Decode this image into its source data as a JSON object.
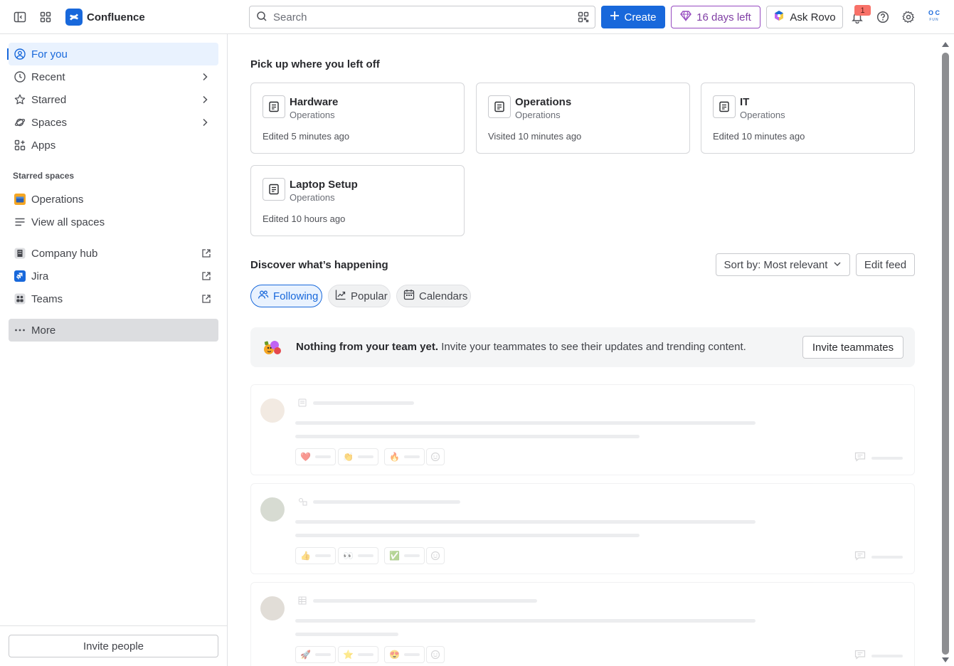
{
  "topbar": {
    "app_name": "Confluence",
    "search_placeholder": "Search",
    "create_label": "Create",
    "trial_label": "16 days left",
    "rovo_label": "Ask Rovo",
    "notification_count": "1",
    "avatar_initials_top": "O C",
    "avatar_initials_bottom": "FUN"
  },
  "sidebar": {
    "items": [
      {
        "label": "For you"
      },
      {
        "label": "Recent"
      },
      {
        "label": "Starred"
      },
      {
        "label": "Spaces"
      },
      {
        "label": "Apps"
      }
    ],
    "starred_heading": "Starred spaces",
    "starred": [
      {
        "label": "Operations"
      },
      {
        "label": "View all spaces"
      }
    ],
    "links": [
      {
        "label": "Company hub"
      },
      {
        "label": "Jira"
      },
      {
        "label": "Teams"
      }
    ],
    "more_label": "More",
    "invite_label": "Invite people"
  },
  "main": {
    "pickup_title": "Pick up where you left off",
    "cards": [
      {
        "title": "Hardware",
        "space": "Operations",
        "meta": "Edited 5 minutes ago"
      },
      {
        "title": "Operations",
        "space": "Operations",
        "meta": "Visited 10 minutes ago"
      },
      {
        "title": "IT",
        "space": "Operations",
        "meta": "Edited 10 minutes ago"
      },
      {
        "title": "Laptop Setup",
        "space": "Operations",
        "meta": "Edited 10 hours ago"
      }
    ],
    "discover_title": "Discover what’s happening",
    "sort_label": "Sort by: Most relevant",
    "edit_feed_label": "Edit feed",
    "filters": [
      {
        "label": "Following"
      },
      {
        "label": "Popular"
      },
      {
        "label": "Calendars"
      }
    ],
    "banner": {
      "bold": "Nothing from your team yet.",
      "text": " Invite your teammates to see their updates and trending content.",
      "button": "Invite teammates"
    },
    "placeholder_reactions": [
      [
        "❤️",
        "👏",
        "🔥"
      ],
      [
        "👍",
        "👀",
        "✅"
      ],
      [
        "🚀",
        "⭐",
        "😍"
      ]
    ]
  },
  "colors": {
    "brand": "#1868db",
    "trial": "#803fa5",
    "badge": "#f87168"
  }
}
